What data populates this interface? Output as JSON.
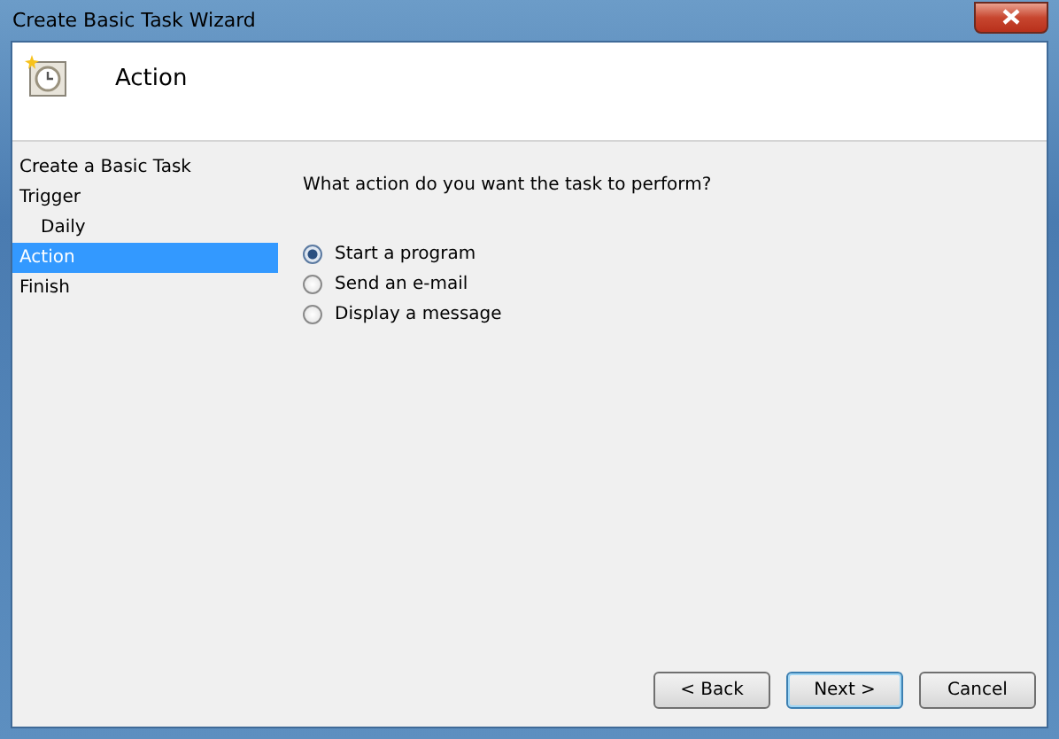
{
  "window": {
    "title": "Create Basic Task Wizard"
  },
  "header": {
    "title": "Action"
  },
  "sidebar": {
    "items": [
      {
        "label": "Create a Basic Task",
        "selected": false
      },
      {
        "label": "Trigger",
        "selected": false,
        "children": [
          {
            "label": "Daily",
            "selected": false
          }
        ]
      },
      {
        "label": "Action",
        "selected": true
      },
      {
        "label": "Finish",
        "selected": false
      }
    ]
  },
  "prompt": "What action do you want the task to perform?",
  "options": [
    {
      "label": "Start a program",
      "selected": true
    },
    {
      "label": "Send an e-mail",
      "selected": false
    },
    {
      "label": "Display a message",
      "selected": false
    }
  ],
  "buttons": [
    {
      "label": "< Back",
      "default": false
    },
    {
      "label": "Next >",
      "default": true
    },
    {
      "label": "Cancel",
      "default": false
    }
  ]
}
